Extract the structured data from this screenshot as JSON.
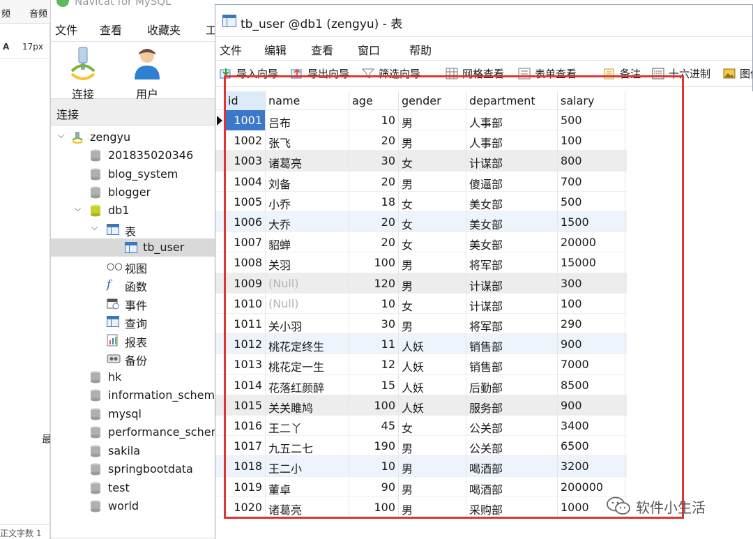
{
  "background_editor": {
    "tabs": [
      "频",
      "音频"
    ],
    "format_row": [
      "A",
      "17px"
    ],
    "side_glyph": "最",
    "status_text": "正文字数 1"
  },
  "navicat": {
    "title": "Navicat for MySQL",
    "menu": [
      "文件",
      "查看",
      "收藏夹",
      "工"
    ],
    "toolbar": {
      "connect_label": "连接",
      "user_label": "用户"
    },
    "connection_header": "连接",
    "tree": {
      "connection": "zengyu",
      "databases": [
        "201835020346",
        "blog_system",
        "blogger",
        "db1"
      ],
      "db1_children": {
        "tables_label": "表",
        "table_item": "tb_user",
        "views_label": "视图",
        "functions_label": "函数",
        "events_label": "事件",
        "queries_label": "查询",
        "reports_label": "报表",
        "backups_label": "备份"
      },
      "more_databases": [
        "hk",
        "information_schema",
        "mysql",
        "performance_schema",
        "sakila",
        "springbootdata",
        "test",
        "world"
      ]
    }
  },
  "table_window": {
    "title": "tb_user @db1 (zengyu) - 表",
    "menu": [
      "文件",
      "编辑",
      "查看",
      "窗口",
      "帮助"
    ],
    "toolbar": [
      {
        "icon": "import-icon",
        "label": "导入向导"
      },
      {
        "icon": "export-icon",
        "label": "导出向导"
      },
      {
        "icon": "filter-icon",
        "label": "筛选向导"
      },
      {
        "icon": "grid-view-icon",
        "label": "网格查看"
      },
      {
        "icon": "form-view-icon",
        "label": "表单查看"
      },
      {
        "icon": "memo-icon",
        "label": "备注"
      },
      {
        "icon": "hex-icon",
        "label": "十六进制"
      },
      {
        "icon": "image-icon",
        "label": "图像"
      }
    ],
    "columns": [
      "id",
      "name",
      "age",
      "gender",
      "department",
      "salary"
    ],
    "rows": [
      [
        "1001",
        "吕布",
        "10",
        "男",
        "人事部",
        "500"
      ],
      [
        "1002",
        "张飞",
        "20",
        "男",
        "人事部",
        "100"
      ],
      [
        "1003",
        "诸葛亮",
        "30",
        "女",
        "计谋部",
        "800"
      ],
      [
        "1004",
        "刘备",
        "20",
        "男",
        "傻逼部",
        "700"
      ],
      [
        "1005",
        "小乔",
        "18",
        "女",
        "美女部",
        "500"
      ],
      [
        "1006",
        "大乔",
        "20",
        "女",
        "美女部",
        "1500"
      ],
      [
        "1007",
        "貂蝉",
        "20",
        "女",
        "美女部",
        "20000"
      ],
      [
        "1008",
        "关羽",
        "100",
        "男",
        "将军部",
        "15000"
      ],
      [
        "1009",
        "(Null)",
        "120",
        "男",
        "计谋部",
        "300"
      ],
      [
        "1010",
        "(Null)",
        "10",
        "女",
        "计谋部",
        "100"
      ],
      [
        "1011",
        "关小羽",
        "30",
        "男",
        "将军部",
        "290"
      ],
      [
        "1012",
        "桃花定终生",
        "11",
        "人妖",
        "销售部",
        "900"
      ],
      [
        "1013",
        "桃花定一生",
        "12",
        "人妖",
        "销售部",
        "7000"
      ],
      [
        "1014",
        "花落红颜醉",
        "15",
        "人妖",
        "后勤部",
        "8500"
      ],
      [
        "1015",
        "关关雎鸠",
        "100",
        "人妖",
        "服务部",
        "900"
      ],
      [
        "1016",
        "王二丫",
        "45",
        "女",
        "公关部",
        "3400"
      ],
      [
        "1017",
        "九五二七",
        "190",
        "男",
        "公关部",
        "6500"
      ],
      [
        "1018",
        "王二小",
        "10",
        "男",
        "喝酒部",
        "3200"
      ],
      [
        "1019",
        "董卓",
        "90",
        "男",
        "喝酒部",
        "200000"
      ],
      [
        "1020",
        "诸葛亮",
        "100",
        "男",
        "采购部",
        "1000"
      ]
    ]
  },
  "watermark": {
    "text": "软件小生活"
  },
  "colors": {
    "selection_blue": "#3a78c9",
    "highlight_red": "#e23333",
    "null_gray": "#b3b3b3"
  }
}
